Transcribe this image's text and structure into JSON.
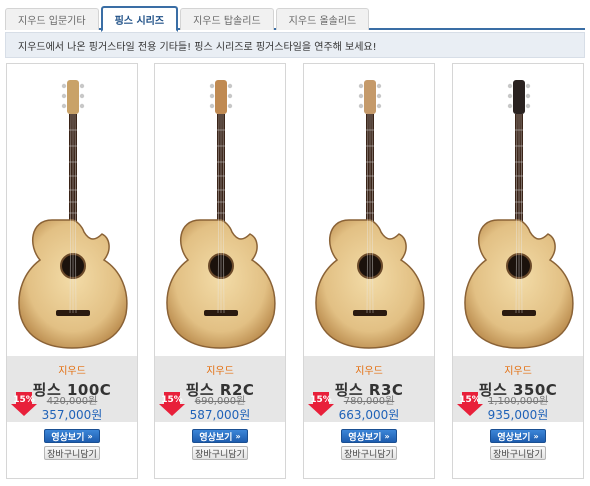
{
  "tabs": [
    {
      "label": "지우드 입문기타",
      "active": false
    },
    {
      "label": "핑스 시리즈",
      "active": true
    },
    {
      "label": "지우드 탑솔리드",
      "active": false
    },
    {
      "label": "지우드 올솔리드",
      "active": false
    }
  ],
  "notice": "지우드에서 나온 핑거스타일 전용 기타들! 핑스 시리즈로 핑거스타일을 연주해 보세요!",
  "products": [
    {
      "brand": "지우드",
      "name": "핑스 100C",
      "old_price": "420,000원",
      "new_price": "357,000원",
      "discount": "15%",
      "headstock_color": "#c9a268",
      "video_label": "영상보기",
      "cart_label": "장바구니담기"
    },
    {
      "brand": "지우드",
      "name": "핑스 R2C",
      "old_price": "690,000원",
      "new_price": "587,000원",
      "discount": "15%",
      "headstock_color": "#c08a52",
      "video_label": "영상보기",
      "cart_label": "장바구니담기"
    },
    {
      "brand": "지우드",
      "name": "핑스 R3C",
      "old_price": "780,000원",
      "new_price": "663,000원",
      "discount": "15%",
      "headstock_color": "#c59a6a",
      "video_label": "영상보기",
      "cart_label": "장바구니담기"
    },
    {
      "brand": "지우드",
      "name": "핑스 350C",
      "old_price": "1,100,000원",
      "new_price": "935,000원",
      "discount": "15%",
      "headstock_color": "#2a2220",
      "video_label": "영상보기",
      "cart_label": "장바구니담기"
    }
  ],
  "icons": {
    "discount": "red-down-arrow-icon",
    "video_chevron": "double-chevron-right-icon"
  },
  "colors": {
    "brand": "#e46c0a",
    "price": "#1f62b8",
    "accent": "#3a6ea5",
    "badge": "#e8203a"
  }
}
